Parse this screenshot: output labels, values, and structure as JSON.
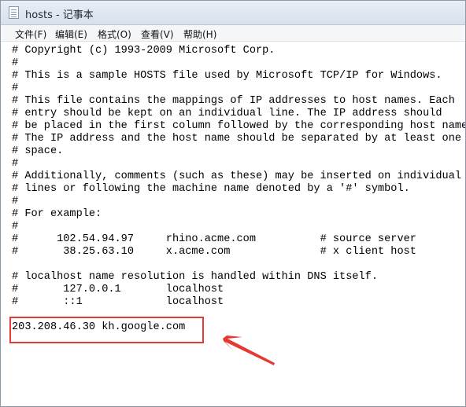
{
  "window": {
    "title": "hosts - 记事本",
    "icon": "notepad-icon"
  },
  "menu": [
    "文件(F)",
    "编辑(E)",
    "格式(O)",
    "查看(V)",
    "帮助(H)"
  ],
  "lines": [
    "# Copyright (c) 1993-2009 Microsoft Corp.",
    "#",
    "# This is a sample HOSTS file used by Microsoft TCP/IP for Windows.",
    "#",
    "# This file contains the mappings of IP addresses to host names. Each",
    "# entry should be kept on an individual line. The IP address should",
    "# be placed in the first column followed by the corresponding host name.",
    "# The IP address and the host name should be separated by at least one",
    "# space.",
    "#",
    "# Additionally, comments (such as these) may be inserted on individual",
    "# lines or following the machine name denoted by a '#' symbol.",
    "#",
    "# For example:",
    "#",
    "#      102.54.94.97     rhino.acme.com          # source server",
    "#       38.25.63.10     x.acme.com              # x client host",
    "",
    "# localhost name resolution is handled within DNS itself.",
    "#       127.0.0.1       localhost",
    "#       ::1             localhost",
    "",
    "203.208.46.30 kh.google.com"
  ],
  "annotation": {
    "color": "#e53935"
  }
}
